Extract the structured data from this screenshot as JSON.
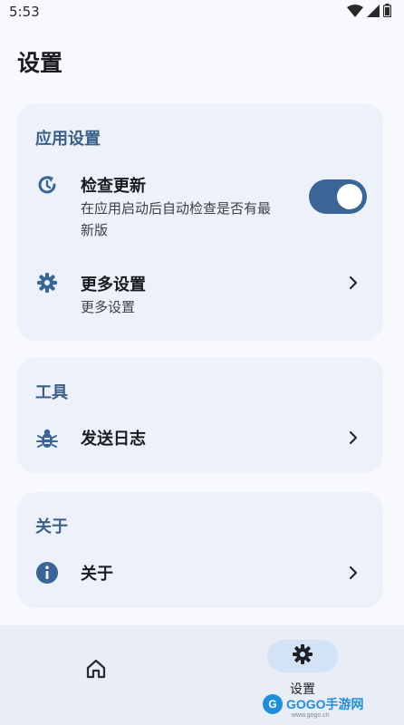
{
  "status_bar": {
    "time": "5:53",
    "icons": [
      "wifi-icon",
      "signal-icon",
      "battery-icon"
    ]
  },
  "page": {
    "title": "设置"
  },
  "sections": {
    "app_settings": {
      "title": "应用设置",
      "check_update": {
        "icon": "update-icon",
        "title": "检查更新",
        "subtitle_line1": "在应用启动后自动检查是否有最",
        "subtitle_line2": "新版",
        "toggle_on": true
      },
      "more_settings": {
        "icon": "gear-icon",
        "title": "更多设置",
        "subtitle": "更多设置"
      }
    },
    "tools": {
      "title": "工具",
      "send_log": {
        "icon": "bug-icon",
        "title": "发送日志"
      }
    },
    "about": {
      "title": "关于",
      "about_item": {
        "icon": "info-icon",
        "title": "关于"
      }
    }
  },
  "bottom_nav": {
    "home": {
      "icon": "home-icon"
    },
    "settings": {
      "icon": "gear-icon",
      "label": "设置",
      "active": true
    }
  },
  "watermark": {
    "logo": "G",
    "text": "GOGO手游网",
    "sub": "www.gogo.cn"
  },
  "colors": {
    "accent": "#3a6596",
    "section_title": "#3a5f8a",
    "card_bg": "#edf1f9",
    "nav_active_pill": "#d4e2f6"
  }
}
